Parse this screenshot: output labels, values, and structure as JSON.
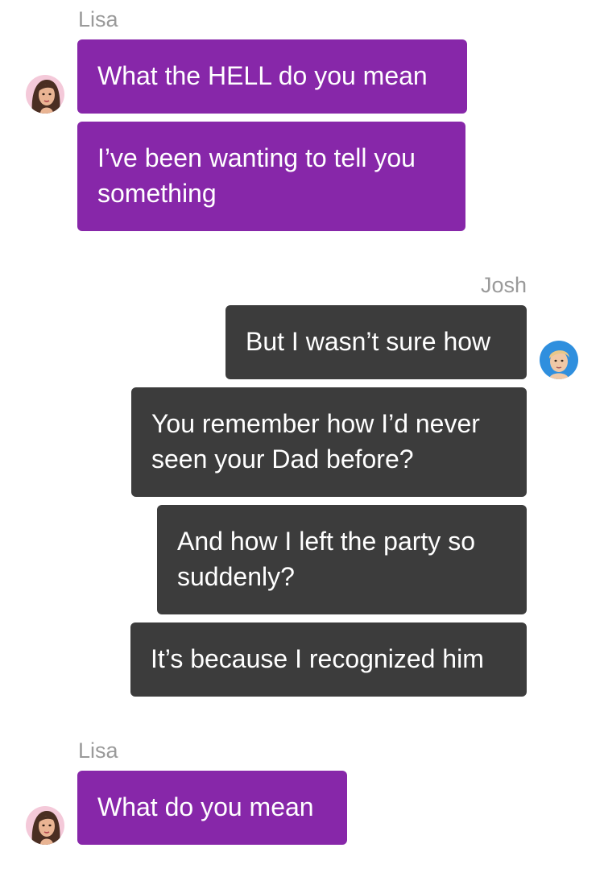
{
  "conversation": {
    "groups": [
      {
        "sender": "Lisa",
        "messages": [
          "What the HELL do you mean",
          "I’ve been wanting to tell you something"
        ]
      },
      {
        "sender": "Josh",
        "messages": [
          "But I wasn’t sure how",
          "You remember how I’d never seen your Dad before?",
          "And how I left the party so suddenly?",
          "It’s because I recognized him"
        ]
      },
      {
        "sender": "Lisa",
        "messages": [
          "What do you mean"
        ]
      }
    ]
  },
  "colors": {
    "lisa_bubble": "#8727a9",
    "josh_bubble": "#3c3c3c",
    "sender_label": "#9a9a9a"
  },
  "icons": {
    "lisa_avatar": "woman-portrait-icon",
    "josh_avatar": "man-portrait-icon"
  }
}
